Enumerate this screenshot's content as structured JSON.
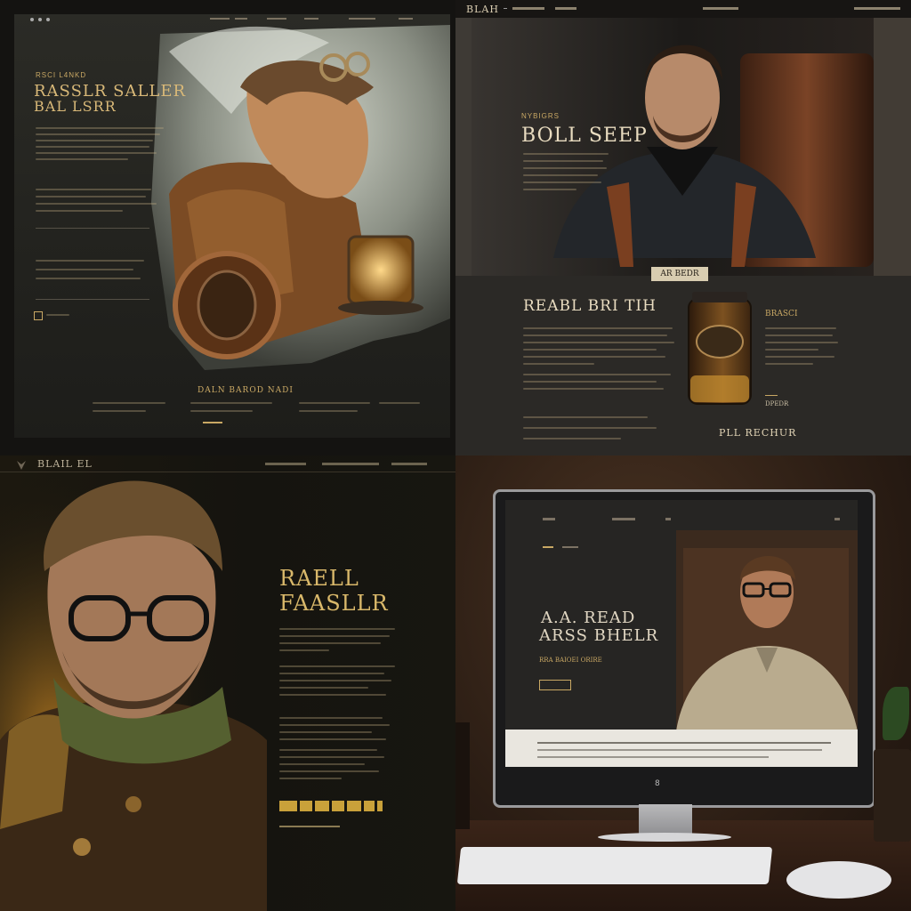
{
  "q1": {
    "nav_items": [
      "",
      "",
      "",
      "",
      "",
      ""
    ],
    "heading_small": "RSCI L4NKD",
    "heading_line1": "RASSLR SALLER",
    "heading_line2": "BAL LSRR",
    "footer_title": "DALN BAROD NADI",
    "footer_links": [
      "",
      "",
      "",
      ""
    ]
  },
  "q2": {
    "brand": "BLAH",
    "nav_items": [
      "",
      ""
    ],
    "eyebrow": "NYBIGRS",
    "heading": "BOLL SEEP",
    "badge": "AR BEDR",
    "section_title": "REABL BRI TIH",
    "side_title": "BRASCI",
    "side_link": "DPEDR",
    "cta": "PLL RECHUR"
  },
  "q3": {
    "brand": "BLAIL EL",
    "nav_items": [
      "",
      "",
      ""
    ],
    "heading_line1": "RAELL",
    "heading_line2": "FAASLLR"
  },
  "q4": {
    "heading_line1": "A.A. READ",
    "heading_line2": "ARSS BHELR",
    "subtitle": "RRA BAIOEI ORIRE",
    "button": "",
    "power_label": "8"
  },
  "colors": {
    "gold": "#c9a864",
    "text_light": "#e9dcc0",
    "panel_dark": "#1d1c19"
  }
}
